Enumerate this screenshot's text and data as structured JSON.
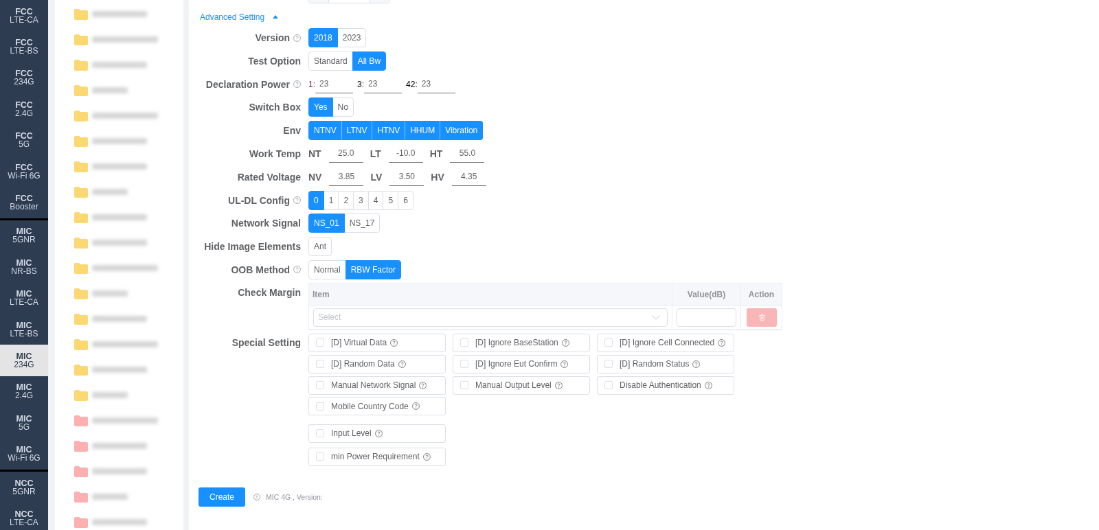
{
  "sidebar": {
    "groups": [
      {
        "items": [
          {
            "title": "FCC",
            "subtitle": "LTE-CA",
            "selected": false
          },
          {
            "title": "FCC",
            "subtitle": "LTE-BS",
            "selected": false
          },
          {
            "title": "FCC",
            "subtitle": "234G",
            "selected": false
          },
          {
            "title": "FCC",
            "subtitle": "2.4G",
            "selected": false
          },
          {
            "title": "FCC",
            "subtitle": "5G",
            "selected": false
          },
          {
            "title": "FCC",
            "subtitle": "Wi-Fi 6G",
            "selected": false
          },
          {
            "title": "FCC",
            "subtitle": "Booster",
            "selected": false
          }
        ]
      },
      {
        "items": [
          {
            "title": "MIC",
            "subtitle": "5GNR",
            "selected": false
          },
          {
            "title": "MIC",
            "subtitle": "NR-BS",
            "selected": false
          },
          {
            "title": "MIC",
            "subtitle": "LTE-CA",
            "selected": false
          },
          {
            "title": "MIC",
            "subtitle": "LTE-BS",
            "selected": false
          },
          {
            "title": "MIC",
            "subtitle": "234G",
            "selected": true
          },
          {
            "title": "MIC",
            "subtitle": "2.4G",
            "selected": false
          },
          {
            "title": "MIC",
            "subtitle": "5G",
            "selected": false
          },
          {
            "title": "MIC",
            "subtitle": "Wi-Fi 6G",
            "selected": false
          }
        ]
      },
      {
        "items": [
          {
            "title": "NCC",
            "subtitle": "5GNR",
            "selected": false
          },
          {
            "title": "NCC",
            "subtitle": "LTE-CA",
            "selected": false
          }
        ]
      }
    ]
  },
  "file_list": {
    "items": [
      {
        "color": "#fcd873"
      },
      {
        "color": "#fcd873"
      },
      {
        "color": "#fcd873"
      },
      {
        "color": "#fcd873"
      },
      {
        "color": "#fcd873"
      },
      {
        "color": "#fcd873"
      },
      {
        "color": "#fcd873"
      },
      {
        "color": "#fcd873"
      },
      {
        "color": "#fcd873"
      },
      {
        "color": "#fcd873"
      },
      {
        "color": "#fcd873"
      },
      {
        "color": "#fcd873"
      },
      {
        "color": "#fcd873"
      },
      {
        "color": "#fcd873"
      },
      {
        "color": "#fcd873"
      },
      {
        "color": "#fcd873"
      },
      {
        "color": "#fdb0b0"
      },
      {
        "color": "#fdb0b0"
      },
      {
        "color": "#fdb0b0"
      },
      {
        "color": "#fdb0b0"
      },
      {
        "color": "#fdb0b0"
      }
    ]
  },
  "form": {
    "section_toggle": {
      "label": "Advanced Setting",
      "expanded": true
    },
    "rows": [
      {
        "kind": "choice",
        "label": "Version",
        "help": true,
        "options": [
          {
            "label": "2018",
            "selected": true
          },
          {
            "label": "2023",
            "selected": false
          }
        ]
      },
      {
        "kind": "choice",
        "label": "Test Option",
        "help": false,
        "options": [
          {
            "label": "Standard",
            "selected": false
          },
          {
            "label": "All Bw",
            "selected": true
          }
        ]
      },
      {
        "kind": "bands",
        "label": "Declaration Power",
        "help": true,
        "fields": [
          {
            "prefix": "1:",
            "color": "#7b1b4a",
            "value": "23"
          },
          {
            "prefix": "3:",
            "color": "#000000",
            "value": "23"
          },
          {
            "prefix": "42:",
            "color": "#000000",
            "value": "23"
          }
        ]
      },
      {
        "kind": "choice",
        "label": "Switch Box",
        "help": false,
        "options": [
          {
            "label": "Yes",
            "selected": true
          },
          {
            "label": "No",
            "selected": false
          }
        ]
      },
      {
        "kind": "choice",
        "label": "Env",
        "help": false,
        "options": [
          {
            "label": "NTNV",
            "selected": true
          },
          {
            "label": "LTNV",
            "selected": true
          },
          {
            "label": "HTNV",
            "selected": true
          },
          {
            "label": "HHUM",
            "selected": true
          },
          {
            "label": "Vibration",
            "selected": true
          }
        ]
      },
      {
        "kind": "levels",
        "label": "Work Temp",
        "help": false,
        "fields": [
          {
            "prefix": "NT",
            "value": "25.0"
          },
          {
            "prefix": "LT",
            "value": "-10.0"
          },
          {
            "prefix": "HT",
            "value": "55.0"
          }
        ]
      },
      {
        "kind": "levels",
        "label": "Rated Voltage",
        "help": false,
        "fields": [
          {
            "prefix": "NV",
            "value": "3.85"
          },
          {
            "prefix": "LV",
            "value": "3.50"
          },
          {
            "prefix": "HV",
            "value": "4.35"
          }
        ]
      },
      {
        "kind": "choice",
        "label": "UL-DL Config",
        "help": true,
        "options": [
          {
            "label": "0",
            "selected": true
          },
          {
            "label": "1",
            "selected": false
          },
          {
            "label": "2",
            "selected": false
          },
          {
            "label": "3",
            "selected": false
          },
          {
            "label": "4",
            "selected": false
          },
          {
            "label": "5",
            "selected": false
          },
          {
            "label": "6",
            "selected": false
          }
        ]
      },
      {
        "kind": "choice",
        "label": "Network Signal",
        "help": false,
        "options": [
          {
            "label": "NS_01",
            "selected": true
          },
          {
            "label": "NS_17",
            "selected": false
          }
        ]
      },
      {
        "kind": "choice",
        "label": "Hide Image Elements",
        "help": false,
        "options": [
          {
            "label": "Ant",
            "selected": false
          }
        ]
      },
      {
        "kind": "choice",
        "label": "OOB Method",
        "help": true,
        "options": [
          {
            "label": "Normal",
            "selected": false
          },
          {
            "label": "RBW Factor",
            "selected": true
          }
        ]
      }
    ],
    "check_margin": {
      "label": "Check Margin",
      "columns": [
        "Item",
        "Value(dB)",
        "Action"
      ],
      "rows": [
        {
          "placeholder": "Select",
          "delete_disabled": true
        }
      ]
    },
    "special_setting": {
      "label": "Special Setting",
      "groups": [
        {
          "options": [
            {
              "label": "[D] Virtual Data",
              "checked": false,
              "help": true
            },
            {
              "label": "[D] Ignore BaseStation",
              "checked": false,
              "help": true
            },
            {
              "label": "[D] Ignore Cell Connected",
              "checked": false,
              "help": true
            },
            {
              "label": "[D] Random Data",
              "checked": false,
              "help": true
            },
            {
              "label": "[D] Ignore Eut Confirm",
              "checked": false,
              "help": true
            },
            {
              "label": "[D] Random Status",
              "checked": false,
              "help": true
            },
            {
              "label": "Manual Network Signal",
              "checked": false,
              "help": true
            },
            {
              "label": "Manual Output Level",
              "checked": false,
              "help": true
            },
            {
              "label": "Disable Authentication",
              "checked": false,
              "help": true
            },
            {
              "label": "Mobile Country Code",
              "checked": false,
              "help": true
            }
          ]
        },
        {
          "options": [
            {
              "label": "Input Level",
              "checked": false,
              "help": true
            }
          ]
        },
        {
          "options": [
            {
              "label": "min Power Requirement",
              "checked": false,
              "help": true
            }
          ]
        }
      ]
    },
    "footer": {
      "button": "Create",
      "note": "MIC 4G , Version:"
    }
  }
}
